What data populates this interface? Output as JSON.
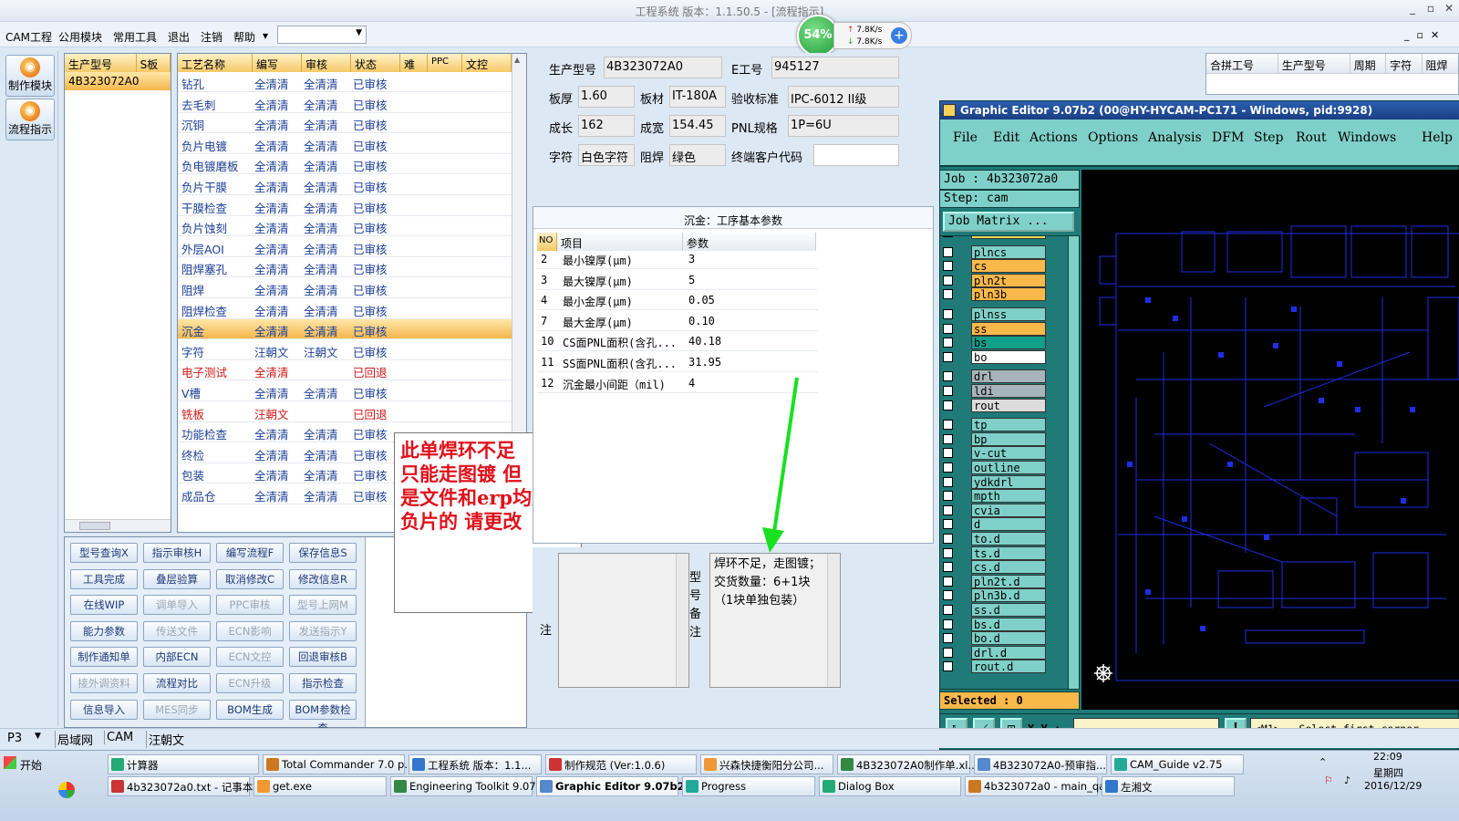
{
  "window": {
    "title": "工程系统   版本：1.1.50.5 - [流程指示]"
  },
  "menu": {
    "items": [
      "CAM工程",
      "公用模块",
      "常用工具",
      "退出",
      "注销",
      "帮助"
    ],
    "help_arrow": "▾"
  },
  "net_widget": {
    "percent": "54%",
    "up": "7.8K/s",
    "down": "7.8K/s"
  },
  "nav": {
    "make_module": "制作模块",
    "flow_guide": "流程指示"
  },
  "model_list": {
    "headers": [
      "生产型号",
      "S板"
    ],
    "rows": [
      "4B323072A0"
    ]
  },
  "process_table": {
    "headers": [
      "工艺名称",
      "编写",
      "审核",
      "状态",
      "难",
      "PPC",
      "文控"
    ],
    "rows": [
      {
        "name": "钻孔",
        "writer": "全清清",
        "reviewer": "全清清",
        "status": "已审核"
      },
      {
        "name": "去毛刺",
        "writer": "全清清",
        "reviewer": "全清清",
        "status": "已审核"
      },
      {
        "name": "沉铜",
        "writer": "全清清",
        "reviewer": "全清清",
        "status": "已审核"
      },
      {
        "name": "负片电镀",
        "writer": "全清清",
        "reviewer": "全清清",
        "status": "已审核"
      },
      {
        "name": "负电镀磨板",
        "writer": "全清清",
        "reviewer": "全清清",
        "status": "已审核"
      },
      {
        "name": "负片干膜",
        "writer": "全清清",
        "reviewer": "全清清",
        "status": "已审核"
      },
      {
        "name": "干膜检查",
        "writer": "全清清",
        "reviewer": "全清清",
        "status": "已审核"
      },
      {
        "name": "负片蚀刻",
        "writer": "全清清",
        "reviewer": "全清清",
        "status": "已审核"
      },
      {
        "name": "外层AOI",
        "writer": "全清清",
        "reviewer": "全清清",
        "status": "已审核"
      },
      {
        "name": "阻焊塞孔",
        "writer": "全清清",
        "reviewer": "全清清",
        "status": "已审核"
      },
      {
        "name": "阻焊",
        "writer": "全清清",
        "reviewer": "全清清",
        "status": "已审核"
      },
      {
        "name": "阻焊检查",
        "writer": "全清清",
        "reviewer": "全清清",
        "status": "已审核"
      },
      {
        "name": "沉金",
        "writer": "全清清",
        "reviewer": "全清清",
        "status": "已审核"
      },
      {
        "name": "字符",
        "writer": "汪朝文",
        "reviewer": "汪朝文",
        "status": "已审核"
      },
      {
        "name": "电子测试",
        "writer": "全清清",
        "reviewer": "",
        "status": "已回退"
      },
      {
        "name": "V槽",
        "writer": "全清清",
        "reviewer": "全清清",
        "status": "已审核"
      },
      {
        "name": "铣板",
        "writer": "汪朝文",
        "reviewer": "",
        "status": "已回退"
      },
      {
        "name": "功能检查",
        "writer": "全清清",
        "reviewer": "全清清",
        "status": "已审核"
      },
      {
        "name": "终检",
        "writer": "全清清",
        "reviewer": "全清清",
        "status": "已审核"
      },
      {
        "name": "包装",
        "writer": "全清清",
        "reviewer": "全清清",
        "status": "已审核"
      },
      {
        "name": "成品仓",
        "writer": "全清清",
        "reviewer": "全清清",
        "status": "已审核"
      }
    ]
  },
  "buttons": [
    [
      "型号查询X",
      "指示审核H",
      "编写流程F",
      "保存信息S"
    ],
    [
      "工具完成",
      "叠层验算",
      "取消修改C",
      "修改信息R"
    ],
    [
      "在线WIP",
      "调单导入",
      "PPC审核",
      "型号上网M"
    ],
    [
      "能力参数",
      "传送文件",
      "ECN影响",
      "发送指示Y"
    ],
    [
      "制作通知单",
      "内部ECN",
      "ECN文控",
      "回退审核B"
    ],
    [
      "接外调资料",
      "流程对比",
      "ECN升级",
      "指示检查"
    ],
    [
      "信息导入",
      "MES同步",
      "BOM生成",
      "BOM参数检查"
    ]
  ],
  "buttons_disabled": [
    "调单导入",
    "PPC审核",
    "型号上网M",
    "传送文件",
    "ECN影响",
    "发送指示Y",
    "ECN文控",
    "接外调资料",
    "ECN升级",
    "MES同步"
  ],
  "annotation": {
    "lines": [
      "此单焊环不足",
      "只能走图镀  但",
      "是文件和erp均是",
      "负片的  请更改"
    ]
  },
  "info": {
    "model_label": "生产型号",
    "model": "4B323072A0",
    "e_label": "E工号",
    "e": "945127",
    "thickness_label": "板厚",
    "thickness": "1.60",
    "material_label": "板材",
    "material": "IT-180A",
    "standard_label": "验收标准",
    "standard": "IPC-6012 II级",
    "len_label": "成长",
    "len": "162",
    "wid_label": "成宽",
    "wid": "154.45",
    "pnl_label": "PNL规格",
    "pnl": "1P=6U",
    "char_label": "字符",
    "char": "白色字符",
    "mask_label": "阻焊",
    "mask": "绿色",
    "cust_label": "终端客户代码",
    "cust": ""
  },
  "params": {
    "title": "沉金：工序基本参数",
    "headers": [
      "NO",
      "项目",
      "参数"
    ],
    "rows": [
      {
        "no": "2",
        "item": "最小镍厚(μm)",
        "val": "3"
      },
      {
        "no": "3",
        "item": "最大镍厚(μm)",
        "val": "5"
      },
      {
        "no": "4",
        "item": "最小金厚(μm)",
        "val": "0.05"
      },
      {
        "no": "7",
        "item": "最大金厚(μm)",
        "val": "0.10"
      },
      {
        "no": "10",
        "item": "CS面PNL面积(含孔...",
        "val": "40.18"
      },
      {
        "no": "11",
        "item": "SS面PNL面积(含孔...",
        "val": "31.95"
      },
      {
        "no": "12",
        "item": "沉金最小间距（mil)",
        "val": "4"
      }
    ]
  },
  "remarks": {
    "left_label": "注",
    "model_label": "型号备注",
    "model_remark": "焊环不足，走图镀；交货数量：6+1块（1块单独包装）"
  },
  "right_grid": {
    "headers": [
      "合拼工号",
      "生产型号",
      "周期",
      "字符",
      "阻焊"
    ]
  },
  "graphic_editor": {
    "title": "Graphic Editor 9.07b2 (00@HY-HYCAM-PC171 - Windows, pid:9928)",
    "menu": [
      "File",
      "Edit",
      "Actions",
      "Options",
      "Analysis",
      "DFM",
      "Step",
      "Rout",
      "Windows",
      "Help"
    ],
    "job": "Job : 4b323072a0",
    "step": "Step: cam",
    "matrix_btn": "Job Matrix ...",
    "layers": [
      {
        "name": "cs",
        "color": "#f8d85a"
      },
      {
        "name": "plncs",
        "color": "#7fd0c8"
      },
      {
        "name": "cs",
        "color": "#f9b84a"
      },
      {
        "name": "pln2t",
        "color": "#f9b84a"
      },
      {
        "name": "pln3b",
        "color": "#f9b84a"
      },
      {
        "name": "plnss",
        "color": "#7fd0c8"
      },
      {
        "name": "ss",
        "color": "#f9b84a"
      },
      {
        "name": "bs",
        "color": "#11a08a"
      },
      {
        "name": "bo",
        "color": "#ffffff"
      },
      {
        "name": "drl",
        "color": "#a8b4bc"
      },
      {
        "name": "ldi",
        "color": "#a8b4bc"
      },
      {
        "name": "rout",
        "color": "#dcdcdc"
      },
      {
        "name": "tp",
        "color": "#7fd0c8"
      },
      {
        "name": "bp",
        "color": "#7fd0c8"
      },
      {
        "name": "v-cut",
        "color": "#7fd0c8"
      },
      {
        "name": "outline",
        "color": "#7fd0c8"
      },
      {
        "name": "ydkdrl",
        "color": "#7fd0c8"
      },
      {
        "name": "mpth",
        "color": "#7fd0c8"
      },
      {
        "name": "cvia",
        "color": "#7fd0c8"
      },
      {
        "name": "d",
        "color": "#7fd0c8"
      },
      {
        "name": "to.d",
        "color": "#7fd0c8"
      },
      {
        "name": "ts.d",
        "color": "#7fd0c8"
      },
      {
        "name": "cs.d",
        "color": "#7fd0c8"
      },
      {
        "name": "pln2t.d",
        "color": "#7fd0c8"
      },
      {
        "name": "pln3b.d",
        "color": "#7fd0c8"
      },
      {
        "name": "ss.d",
        "color": "#7fd0c8"
      },
      {
        "name": "bs.d",
        "color": "#7fd0c8"
      },
      {
        "name": "bo.d",
        "color": "#7fd0c8"
      },
      {
        "name": "drl.d",
        "color": "#7fd0c8"
      },
      {
        "name": "rout.d",
        "color": "#7fd0c8"
      }
    ],
    "selected": "Selected : 0",
    "xy_label": "X Y :",
    "status": "<M1> - Select first corner"
  },
  "status_bar": {
    "items": [
      "P3",
      "局域网",
      "CAM",
      "汪朝文"
    ]
  },
  "taskbar": {
    "start": "开始",
    "row1": [
      "计算器",
      "Total Commander 7.0 p...",
      "工程系统  版本：1.1...",
      "制作规范 (Ver:1.0.6)",
      "兴森快捷衡阳分公司...",
      "4B323072A0制作单.xl...",
      "4B323072A0-预审指...",
      "CAM_Guide v2.75"
    ],
    "row2": [
      "4b323072a0.txt - 记事本",
      "get.exe",
      "Engineering Toolkit 9.07...",
      "Graphic Editor 9.07b2 ...",
      "Progress",
      "Dialog Box",
      "4b323072a0 - main_qa",
      "左湘文"
    ],
    "time": "22:09",
    "weekday": "星期四",
    "date": "2016/12/29"
  }
}
